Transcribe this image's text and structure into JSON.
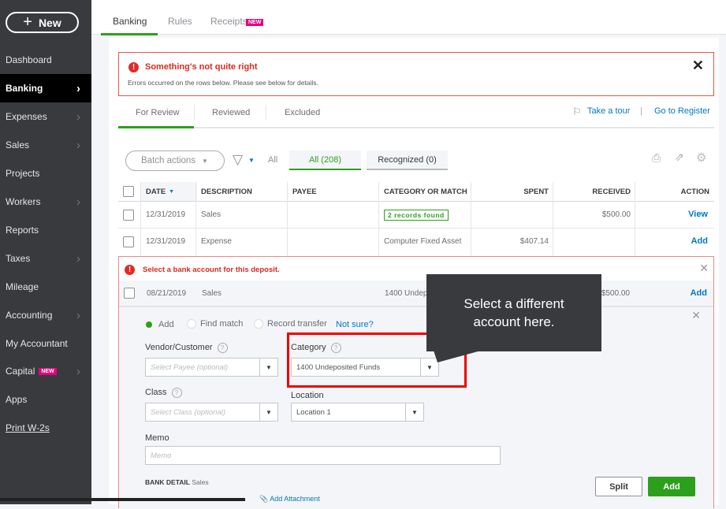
{
  "sidebar": {
    "new_label": "New",
    "items": [
      {
        "label": "Dashboard",
        "chevron": false
      },
      {
        "label": "Banking",
        "chevron": true,
        "active": true
      },
      {
        "label": "Expenses",
        "chevron": true
      },
      {
        "label": "Sales",
        "chevron": true
      },
      {
        "label": "Projects",
        "chevron": false
      },
      {
        "label": "Workers",
        "chevron": true
      },
      {
        "label": "Reports",
        "chevron": false
      },
      {
        "label": "Taxes",
        "chevron": true
      },
      {
        "label": "Mileage",
        "chevron": false
      },
      {
        "label": "Accounting",
        "chevron": true
      },
      {
        "label": "My Accountant",
        "chevron": false
      },
      {
        "label": "Capital",
        "chevron": true,
        "badge": "NEW"
      },
      {
        "label": "Apps",
        "chevron": false
      },
      {
        "label": "Print W-2s",
        "chevron": false
      }
    ]
  },
  "top_tabs": {
    "banking": "Banking",
    "rules": "Rules",
    "receipts": "Receipts",
    "receipts_badge": "NEW"
  },
  "error_banner": {
    "title": "Something's not quite right",
    "message": "Errors occurred on the rows below. Please see below for details."
  },
  "sub_tabs": {
    "for_review": "For Review",
    "reviewed": "Reviewed",
    "excluded": "Excluded"
  },
  "links": {
    "take_tour": "Take a tour",
    "separator": "|",
    "go_register": "Go to Register"
  },
  "filters": {
    "batch_actions": "Batch actions",
    "all": "All",
    "all_count": "All (208)",
    "recognized": "Recognized (0)"
  },
  "table": {
    "headers": {
      "date": "DATE",
      "description": "DESCRIPTION",
      "payee": "PAYEE",
      "category": "CATEGORY OR MATCH",
      "spent": "SPENT",
      "received": "RECEIVED",
      "action": "ACTION"
    },
    "rows": [
      {
        "date": "12/31/2019",
        "description": "Sales",
        "payee": "",
        "category": "2 records found",
        "spent": "",
        "received": "$500.00",
        "action": "View"
      },
      {
        "date": "12/31/2019",
        "description": "Expense",
        "payee": "",
        "category": "Computer Fixed Asset",
        "spent": "$407.14",
        "received": "",
        "action": "Add"
      }
    ]
  },
  "error_row": {
    "message": "Select a bank account for this deposit.",
    "date": "08/21/2019",
    "description": "Sales",
    "category": "1400 Undeposited Funds",
    "received": "$500.00",
    "action": "Add"
  },
  "form": {
    "radio_add": "Add",
    "radio_find": "Find match",
    "radio_transfer": "Record transfer",
    "not_sure": "Not sure?",
    "vendor_label": "Vendor/Customer",
    "vendor_placeholder": "Select Payee (optional)",
    "category_label": "Category",
    "category_value": "1400 Undeposited Funds",
    "class_label": "Class",
    "class_placeholder": "Select Class (optional)",
    "location_label": "Location",
    "location_value": "Location 1",
    "memo_label": "Memo",
    "memo_placeholder": "Memo",
    "bank_detail_label": "BANK DETAIL",
    "bank_detail_value": "Sales",
    "add_attachment": "Add Attachment",
    "split": "Split",
    "add": "Add"
  },
  "callout": {
    "text": "Select a different account here."
  },
  "colors": {
    "green": "#2ca01c",
    "red": "#d52b1e",
    "blue": "#0077c5",
    "sidebar": "#393a3d"
  }
}
